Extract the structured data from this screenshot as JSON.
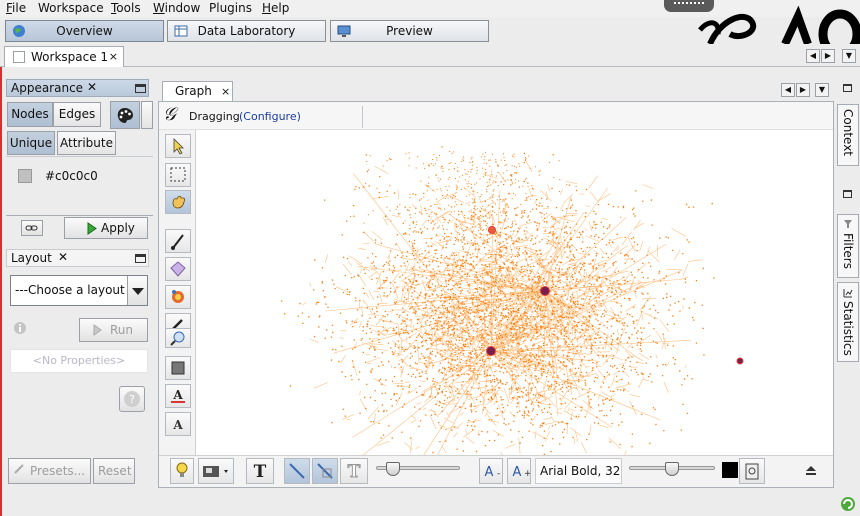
{
  "menubar": {
    "items": [
      {
        "label": "File",
        "accel": "F"
      },
      {
        "label": "Workspace",
        "accel": ""
      },
      {
        "label": "Tools",
        "accel": "T"
      },
      {
        "label": "Window",
        "accel": "W"
      },
      {
        "label": "Plugins",
        "accel": ""
      },
      {
        "label": "Help",
        "accel": "H"
      }
    ]
  },
  "modes": {
    "overview": "Overview",
    "data_lab": "Data Laboratory",
    "preview": "Preview",
    "active": "overview"
  },
  "workspace_tab": {
    "label": "Workspace 1",
    "close": "×"
  },
  "appearance": {
    "title": "Appearance",
    "close": "✕",
    "tabs": {
      "nodes": "Nodes",
      "edges": "Edges"
    },
    "subtabs": {
      "unique": "Unique",
      "attribute": "Attribute"
    },
    "color_label": "#c0c0c0",
    "color_value": "#c0c0c0",
    "apply": "Apply"
  },
  "layout": {
    "title": "Layout",
    "close": "✕",
    "combo": "---Choose a layout",
    "run": "Run",
    "no_props": "<No Properties>",
    "presets": "Presets...",
    "reset": "Reset"
  },
  "graph": {
    "tab_label": "Graph",
    "close": "×",
    "status_mode": "Dragging",
    "configure": "(Configure)",
    "node_color": "#ff7f0e",
    "edge_color": "#ff8c1a",
    "hub_color": "#7a1e4e"
  },
  "bottom": {
    "font": "Arial Bold, 32",
    "text_size_level": 0.2,
    "edge_scale_level": 0.5
  },
  "right_tabs": {
    "context": "Context",
    "filters": "Filters",
    "statistics": "Statistics"
  }
}
